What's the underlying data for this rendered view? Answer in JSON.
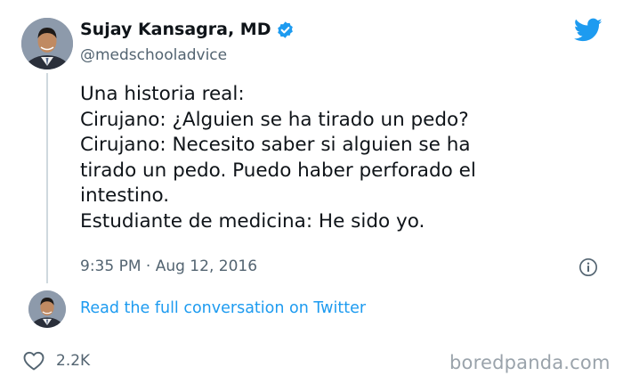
{
  "author": {
    "display_name": "Sujay Kansagra, MD",
    "handle": "@medschooladvice",
    "verified": true
  },
  "tweet": {
    "lines": [
      "Una historia real:",
      "Cirujano: ¿Alguien se ha tirado un pedo?",
      "Cirujano: Necesito saber si alguien se ha",
      "tirado un pedo. Puedo haber perforado el",
      "intestino.",
      "Estudiante de medicina: He sido yo."
    ],
    "timestamp": "9:35 PM · Aug 12, 2016"
  },
  "conversation_link": "Read the full conversation on Twitter",
  "engagement": {
    "likes": "2.2K"
  },
  "watermark": "boredpanda.com",
  "icons": {
    "brand": "twitter-bird-icon",
    "verified": "verified-badge-icon",
    "info": "info-icon",
    "like": "heart-icon"
  },
  "colors": {
    "twitter_blue": "#1d9bf0",
    "text": "#0f1419",
    "secondary_text": "#536471",
    "thread_line": "#cfd9de",
    "watermark": "#9aa3ab"
  }
}
